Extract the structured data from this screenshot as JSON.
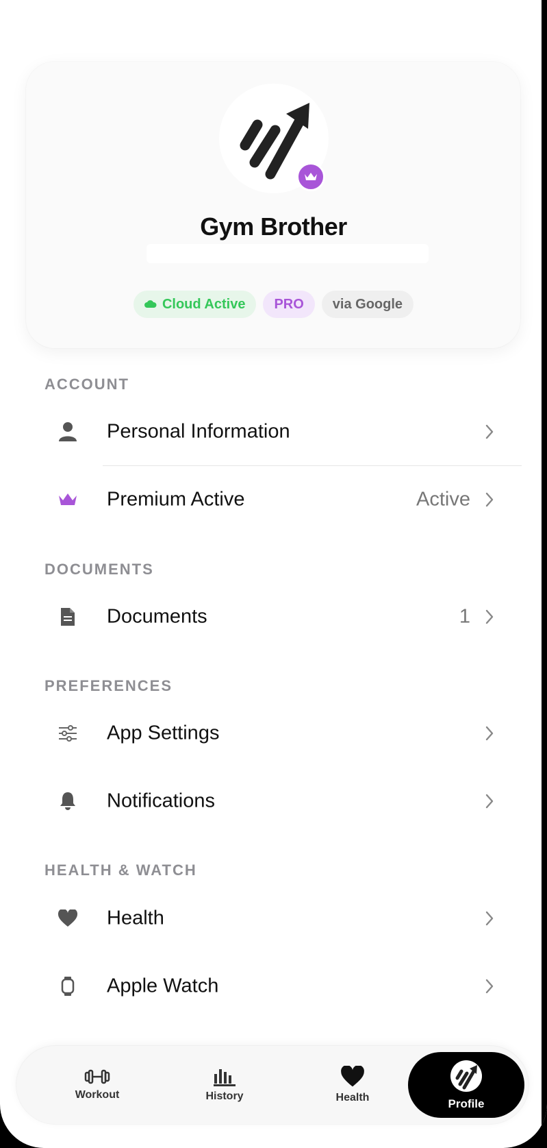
{
  "profile": {
    "name": "Gym Brother",
    "badges": [
      {
        "label": "Cloud Active"
      },
      {
        "label": "PRO"
      },
      {
        "label": "via Google"
      }
    ]
  },
  "sections": {
    "account": {
      "title": "ACCOUNT",
      "items": [
        {
          "label": "Personal Information",
          "value": ""
        },
        {
          "label": "Premium Active",
          "value": "Active"
        }
      ]
    },
    "documents": {
      "title": "DOCUMENTS",
      "items": [
        {
          "label": "Documents",
          "value": "1"
        }
      ]
    },
    "preferences": {
      "title": "PREFERENCES",
      "items": [
        {
          "label": "App Settings",
          "value": ""
        },
        {
          "label": "Notifications",
          "value": ""
        }
      ]
    },
    "health": {
      "title": "HEALTH & WATCH",
      "items": [
        {
          "label": "Health",
          "value": ""
        },
        {
          "label": "Apple Watch",
          "value": ""
        }
      ]
    }
  },
  "tabbar": {
    "tabs": [
      {
        "label": "Workout",
        "icon": "dumbbell-icon"
      },
      {
        "label": "History",
        "icon": "bar-chart-icon"
      },
      {
        "label": "Health",
        "icon": "heart-icon"
      },
      {
        "label": "Profile",
        "icon": "app-logo-icon",
        "active": true
      }
    ]
  },
  "colors": {
    "accent_purple": "#a855d8",
    "cloud_green": "#34c759",
    "text_secondary": "#8e8e93"
  }
}
